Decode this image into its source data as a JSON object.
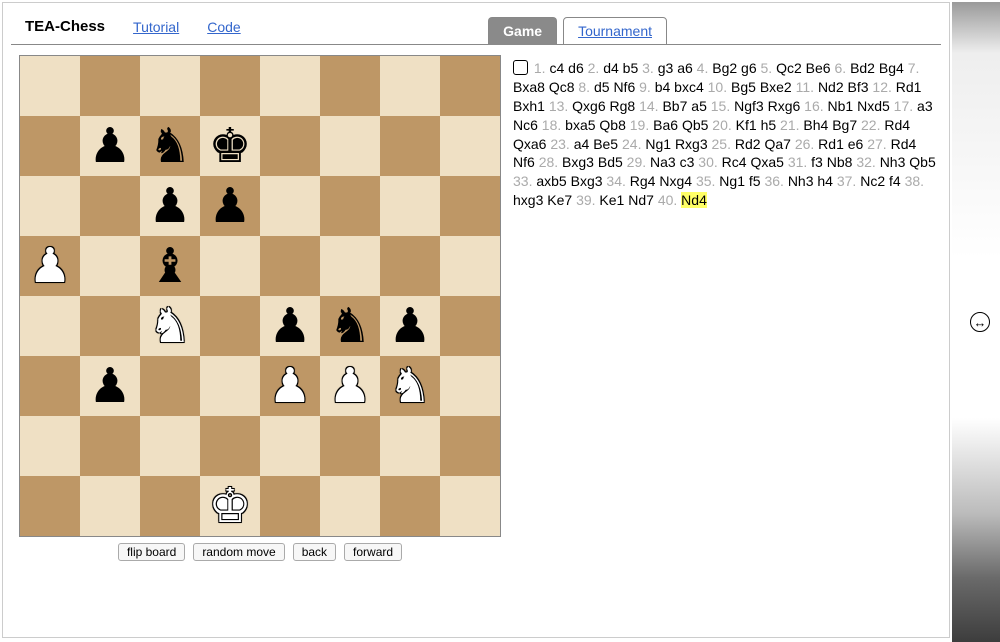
{
  "header": {
    "title": "TEA-Chess",
    "links": [
      "Tutorial",
      "Code"
    ],
    "tabs": [
      {
        "label": "Game",
        "active": true
      },
      {
        "label": "Tournament",
        "active": false
      }
    ]
  },
  "controls": {
    "flip": "flip board",
    "random": "random move",
    "back": "back",
    "forward": "forward"
  },
  "side_to_move": "white",
  "board": [
    [
      null,
      null,
      null,
      null,
      null,
      null,
      null,
      null
    ],
    [
      null,
      {
        "p": "p",
        "c": "b"
      },
      {
        "p": "n",
        "c": "b"
      },
      {
        "p": "k",
        "c": "b"
      },
      null,
      null,
      null,
      null
    ],
    [
      null,
      null,
      {
        "p": "p",
        "c": "b"
      },
      {
        "p": "p",
        "c": "b"
      },
      null,
      null,
      null,
      null
    ],
    [
      {
        "p": "p",
        "c": "w"
      },
      null,
      {
        "p": "b",
        "c": "b"
      },
      null,
      null,
      null,
      null,
      null
    ],
    [
      null,
      null,
      {
        "p": "n",
        "c": "w"
      },
      null,
      {
        "p": "p",
        "c": "b"
      },
      {
        "p": "n",
        "c": "b"
      },
      {
        "p": "p",
        "c": "b"
      },
      null
    ],
    [
      null,
      {
        "p": "p",
        "c": "b"
      },
      null,
      null,
      {
        "p": "p",
        "c": "w"
      },
      {
        "p": "p",
        "c": "w"
      },
      {
        "p": "n",
        "c": "w"
      },
      null
    ],
    [
      null,
      null,
      null,
      null,
      null,
      null,
      null,
      null
    ],
    [
      null,
      null,
      null,
      {
        "p": "k",
        "c": "w"
      },
      null,
      null,
      null,
      null
    ]
  ],
  "moves": [
    {
      "n": 1,
      "w": "c4",
      "b": "d6"
    },
    {
      "n": 2,
      "w": "d4",
      "b": "b5"
    },
    {
      "n": 3,
      "w": "g3",
      "b": "a6"
    },
    {
      "n": 4,
      "w": "Bg2",
      "b": "g6"
    },
    {
      "n": 5,
      "w": "Qc2",
      "b": "Be6"
    },
    {
      "n": 6,
      "w": "Bd2",
      "b": "Bg4"
    },
    {
      "n": 7,
      "w": "Bxa8",
      "b": "Qc8"
    },
    {
      "n": 8,
      "w": "d5",
      "b": "Nf6"
    },
    {
      "n": 9,
      "w": "b4",
      "b": "bxc4"
    },
    {
      "n": 10,
      "w": "Bg5",
      "b": "Bxe2"
    },
    {
      "n": 11,
      "w": "Nd2",
      "b": "Bf3"
    },
    {
      "n": 12,
      "w": "Rd1",
      "b": "Bxh1"
    },
    {
      "n": 13,
      "w": "Qxg6",
      "b": "Rg8"
    },
    {
      "n": 14,
      "w": "Bb7",
      "b": "a5"
    },
    {
      "n": 15,
      "w": "Ngf3",
      "b": "Rxg6"
    },
    {
      "n": 16,
      "w": "Nb1",
      "b": "Nxd5"
    },
    {
      "n": 17,
      "w": "a3",
      "b": "Nc6"
    },
    {
      "n": 18,
      "w": "bxa5",
      "b": "Qb8"
    },
    {
      "n": 19,
      "w": "Ba6",
      "b": "Qb5"
    },
    {
      "n": 20,
      "w": "Kf1",
      "b": "h5"
    },
    {
      "n": 21,
      "w": "Bh4",
      "b": "Bg7"
    },
    {
      "n": 22,
      "w": "Rd4",
      "b": "Qxa6"
    },
    {
      "n": 23,
      "w": "a4",
      "b": "Be5"
    },
    {
      "n": 24,
      "w": "Ng1",
      "b": "Rxg3"
    },
    {
      "n": 25,
      "w": "Rd2",
      "b": "Qa7"
    },
    {
      "n": 26,
      "w": "Rd1",
      "b": "e6"
    },
    {
      "n": 27,
      "w": "Rd4",
      "b": "Nf6"
    },
    {
      "n": 28,
      "w": "Bxg3",
      "b": "Bd5"
    },
    {
      "n": 29,
      "w": "Na3",
      "b": "c3"
    },
    {
      "n": 30,
      "w": "Rc4",
      "b": "Qxa5"
    },
    {
      "n": 31,
      "w": "f3",
      "b": "Nb8"
    },
    {
      "n": 32,
      "w": "Nh3",
      "b": "Qb5"
    },
    {
      "n": 33,
      "w": "axb5",
      "b": "Bxg3"
    },
    {
      "n": 34,
      "w": "Rg4",
      "b": "Nxg4"
    },
    {
      "n": 35,
      "w": "Ng1",
      "b": "f5"
    },
    {
      "n": 36,
      "w": "Nh3",
      "b": "h4"
    },
    {
      "n": 37,
      "w": "Nc2",
      "b": "f4"
    },
    {
      "n": 38,
      "w": "hxg3",
      "b": "Ke7"
    },
    {
      "n": 39,
      "w": "Ke1",
      "b": "Nd7"
    },
    {
      "n": 40,
      "w": "Nd4",
      "b": null
    }
  ],
  "highlight_move": {
    "n": 40,
    "side": "w"
  },
  "piece_glyphs": {
    "k": "♚",
    "q": "♛",
    "r": "♜",
    "b": "♝",
    "n": "♞",
    "p": "♟"
  }
}
